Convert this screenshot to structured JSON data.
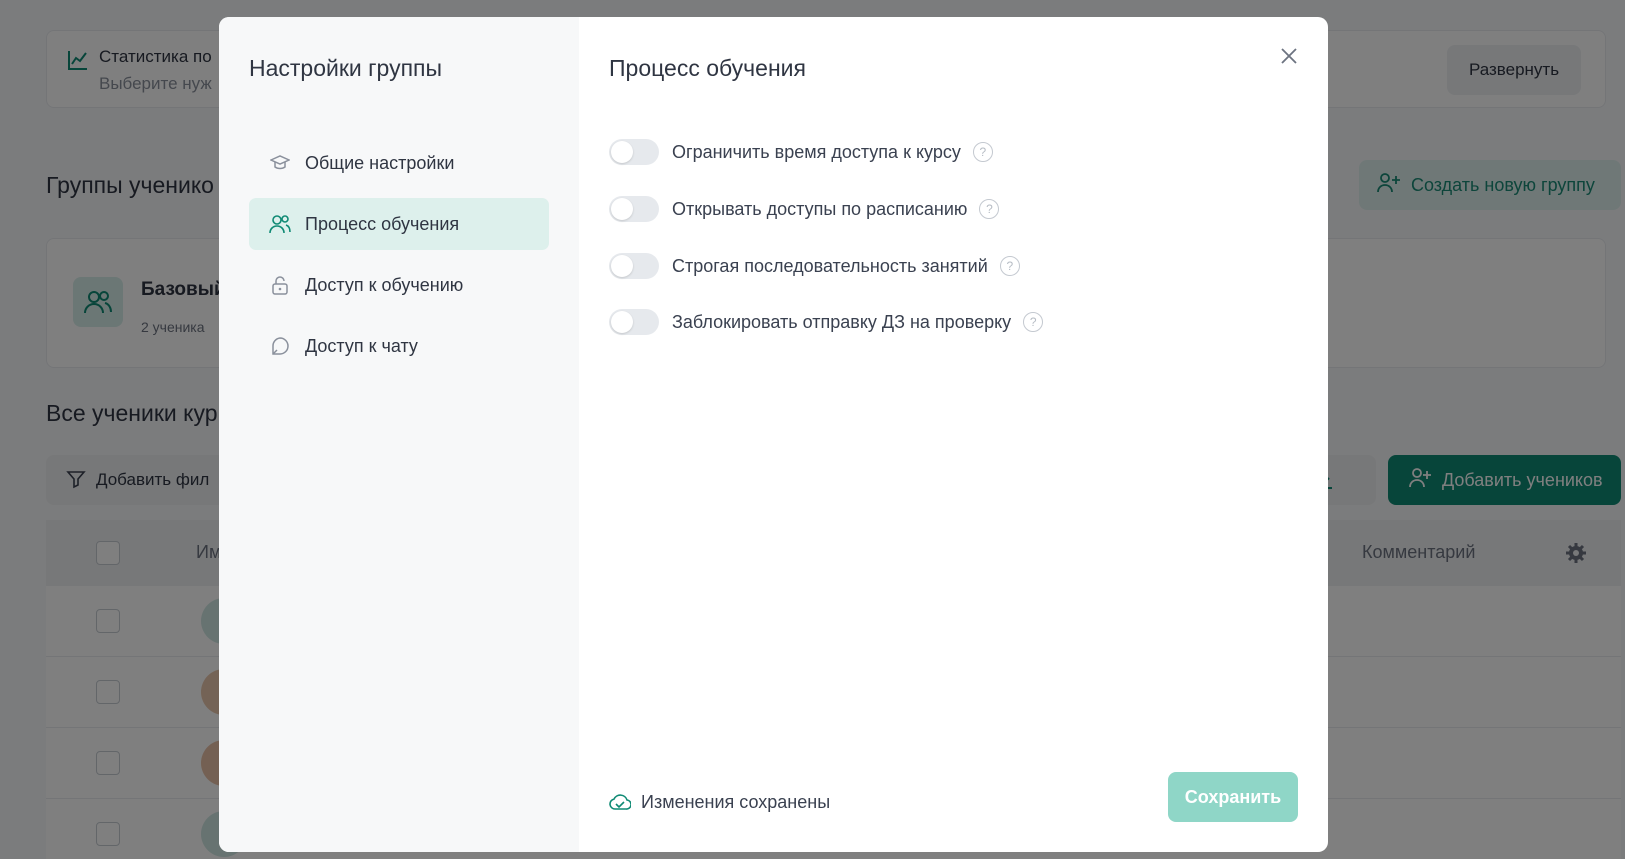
{
  "background": {
    "stats": {
      "title": "Статистика по",
      "subtitle": "Выберите нуж",
      "expand_label": "Развернуть"
    },
    "groups_heading": "Группы ученико",
    "create_group_label": "Создать новую группу",
    "group": {
      "name": "Базовый",
      "count": "2 ученика"
    },
    "all_students_heading": "Все ученики кур",
    "filter_label": "Добавить фил",
    "add_students_label": "Добавить учеников",
    "table": {
      "col_name": "Им",
      "col_comment": "Комментарий"
    }
  },
  "modal": {
    "sidebar_title": "Настройки группы",
    "nav": [
      {
        "label": "Общие настройки",
        "icon": "graduation-cap-icon",
        "active": false
      },
      {
        "label": "Процесс обучения",
        "icon": "users-icon",
        "active": true
      },
      {
        "label": "Доступ к обучению",
        "icon": "unlock-icon",
        "active": false
      },
      {
        "label": "Доступ к чату",
        "icon": "chat-icon",
        "active": false
      }
    ],
    "title": "Процесс обучения",
    "options": [
      {
        "label": "Ограничить время доступа к курсу",
        "enabled": false
      },
      {
        "label": "Открывать доступы по расписанию",
        "enabled": false
      },
      {
        "label": "Строгая последовательность занятий",
        "enabled": false
      },
      {
        "label": "Заблокировать отправку ДЗ на проверку",
        "enabled": false
      }
    ],
    "help_glyph": "?",
    "saved_status": "Изменения сохранены",
    "save_label": "Сохранить"
  },
  "colors": {
    "accent": "#0f8a74",
    "active_nav_bg": "#ddf0ec",
    "save_button_bg": "#8fd6c7"
  }
}
